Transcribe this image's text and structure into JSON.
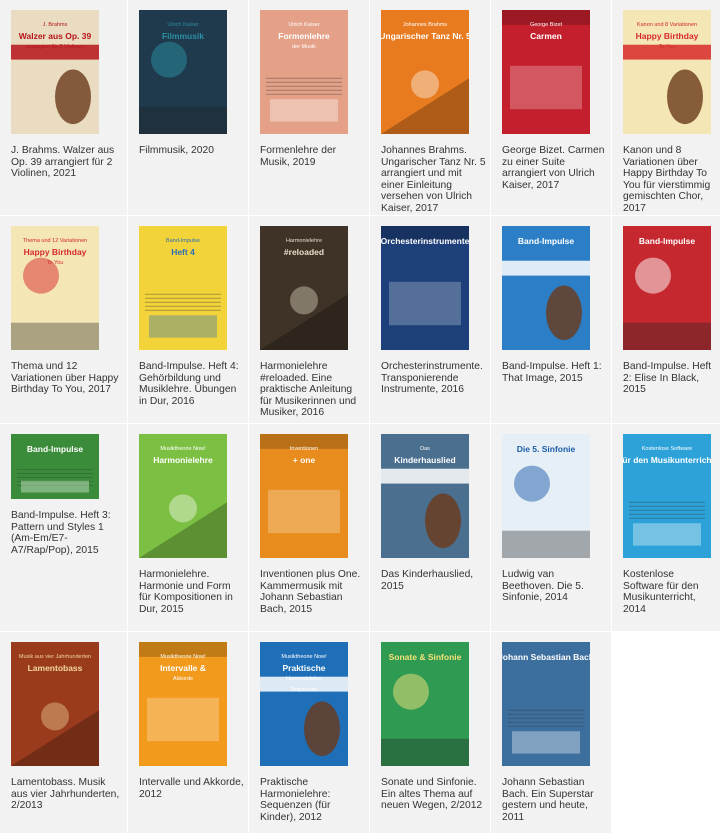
{
  "items": [
    {
      "caption": "J. Brahms. Walzer aus Op. 39 arrangiert für 2 Violinen, 2021",
      "cover_text": [
        "J. Brahms",
        "Walzer aus Op. 39",
        "arrangiert für 2 Violinen"
      ],
      "colors": {
        "bg": "#e9dcc0",
        "accent": "#b7141b"
      }
    },
    {
      "caption": "Filmmusik, 2020",
      "cover_text": [
        "Ulrich Kaiser",
        "Filmmusik"
      ],
      "colors": {
        "bg": "#1e3a4c",
        "accent": "#2b8fa3"
      }
    },
    {
      "caption": "Formenlehre der Musik, 2019",
      "cover_text": [
        "Ulrich Kaiser",
        "Formenlehre",
        "der Musik"
      ],
      "colors": {
        "bg": "#e4a188",
        "accent": "#ffffff"
      }
    },
    {
      "caption": "Johannes Brahms. Ungarischer Tanz Nr. 5 arrangiert und mit einer Einleitung versehen von Ulrich Kaiser, 2017",
      "cover_text": [
        "Johannes Brahms",
        "Ungarischer Tanz Nr. 5"
      ],
      "colors": {
        "bg": "#e87b1f",
        "accent": "#ffffff"
      }
    },
    {
      "caption": "George Bizet. Carmen zu einer Suite arrangiert von Ulrich Kaiser, 2017",
      "cover_text": [
        "George Bizet",
        "Carmen"
      ],
      "colors": {
        "bg": "#c41f2c",
        "accent": "#ffffff"
      }
    },
    {
      "caption": "Kanon und 8 Variationen über Happy Birthday To You für vierstimmig gemischten Chor, 2017",
      "cover_text": [
        "Kanon und 8 Variationen",
        "Happy Birthday",
        "To You"
      ],
      "colors": {
        "bg": "#f4e6b5",
        "accent": "#d62a2a"
      }
    },
    {
      "caption": "Thema und 12 Variationen über Happy Birthday To You, 2017",
      "cover_text": [
        "Thema und 12 Variationen",
        "Happy Birthday",
        "To You"
      ],
      "colors": {
        "bg": "#f4e6b5",
        "accent": "#d62a2a"
      }
    },
    {
      "caption": "Band-Impulse. Heft 4: Gehörbildung und Musiklehre. Übungen in Dur, 2016",
      "cover_text": [
        "Band-Impulse",
        "Heft 4"
      ],
      "colors": {
        "bg": "#f2d33a",
        "accent": "#2b6fb4"
      }
    },
    {
      "caption": "Harmonielehre #reloaded. Eine praktische Anleitung für Musikerinnen und Musiker, 2016",
      "cover_text": [
        "Harmonielehre",
        "#reloaded"
      ],
      "colors": {
        "bg": "#3e3326",
        "accent": "#e8e0cc"
      }
    },
    {
      "caption": "Orchesterinstrumente. Transponierende Instrumente, 2016",
      "cover_text": [
        "Orchesterinstrumente"
      ],
      "colors": {
        "bg": "#1d3f7a",
        "accent": "#ffffff"
      }
    },
    {
      "caption": "Band-Impulse. Heft 1: That Image, 2015",
      "cover_text": [
        "Band-Impulse"
      ],
      "colors": {
        "bg": "#2c7fc6",
        "accent": "#ffffff"
      }
    },
    {
      "caption": "Band-Impulse. Heft 2: Elise In Black, 2015",
      "cover_text": [
        "Band-Impulse"
      ],
      "colors": {
        "bg": "#c6282f",
        "accent": "#ffffff"
      }
    },
    {
      "caption": "Band-Impulse. Heft 3: Pattern und Styles 1 (Am-Em/E7-A7/Rap/Pop), 2015",
      "cover_text": [
        "Band-Impulse"
      ],
      "colors": {
        "bg": "#3b8c3a",
        "accent": "#ffffff"
      }
    },
    {
      "caption": "Harmonielehre. Harmonie und Form für Kompositionen in Dur, 2015",
      "cover_text": [
        "Musiktheorie Now!",
        "Harmonielehre"
      ],
      "colors": {
        "bg": "#7cc043",
        "accent": "#ffffff"
      }
    },
    {
      "caption": "Inventionen plus One. Kammermusik mit Johann Sebastian Bach, 2015",
      "cover_text": [
        "Inventionen",
        "+ one"
      ],
      "colors": {
        "bg": "#e88d1d",
        "accent": "#ffffff"
      }
    },
    {
      "caption": "Das Kinderhauslied, 2015",
      "cover_text": [
        "Das",
        "Kinderhauslied"
      ],
      "colors": {
        "bg": "#4a6f8f",
        "accent": "#ffffff"
      }
    },
    {
      "caption": "Ludwig van Beethoven. Die 5. Sinfonie, 2014",
      "cover_text": [
        "Die 5. Sinfonie"
      ],
      "colors": {
        "bg": "#e6eef6",
        "accent": "#1d5ea8"
      }
    },
    {
      "caption": "Kostenlose Software für den Musikunterricht, 2014",
      "cover_text": [
        "Kostenlose Software",
        "für den Musikunterricht"
      ],
      "colors": {
        "bg": "#2da2d8",
        "accent": "#ffffff"
      }
    },
    {
      "caption": "Lamentobass. Musik aus vier Jahrhunderten, 2/2013",
      "cover_text": [
        "Musik aus vier Jahrhunderten",
        "Lamentobass"
      ],
      "colors": {
        "bg": "#9a3b1e",
        "accent": "#f2d8a0"
      }
    },
    {
      "caption": "Intervalle und Akkorde, 2012",
      "cover_text": [
        "Musiktheorie Now!",
        "Intervalle &",
        "Akkorde"
      ],
      "colors": {
        "bg": "#f29a1c",
        "accent": "#ffffff"
      }
    },
    {
      "caption": "Praktische Harmonielehre: Sequenzen (für Kinder), 2012",
      "cover_text": [
        "Musiktheorie Now!",
        "Praktische",
        "Harmonielehre",
        "Sequenzen"
      ],
      "colors": {
        "bg": "#1e6fb8",
        "accent": "#ffffff"
      }
    },
    {
      "caption": "Sonate und Sinfonie. Ein altes Thema auf neuen Wegen, 2/2012",
      "cover_text": [
        "Sonate & Sinfonie"
      ],
      "colors": {
        "bg": "#2f9a52",
        "accent": "#f4e27a"
      }
    },
    {
      "caption": "Johann Sebastian Bach. Ein Superstar gestern und heute, 2011",
      "cover_text": [
        "Johann Sebastian Bach"
      ],
      "colors": {
        "bg": "#3d6f9e",
        "accent": "#ffffff"
      }
    }
  ]
}
